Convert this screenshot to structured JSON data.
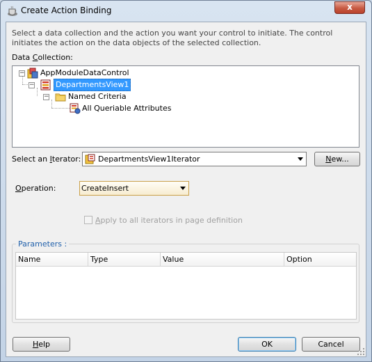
{
  "window": {
    "title": "Create Action Binding",
    "close_glyph": "x"
  },
  "description": "Select a data collection and the action you want your control to initiate. The control initiates the action on the data objects of the selected collection.",
  "data_collection": {
    "label_pre": "Data ",
    "label_key": "C",
    "label_post": "ollection:",
    "tree": [
      {
        "label": "AppModuleDataControl",
        "icon": "data-control-icon",
        "expanded": true
      },
      {
        "label": "DepartmentsView1",
        "icon": "view-object-icon",
        "expanded": true,
        "selected": true
      },
      {
        "label": "Named Criteria",
        "icon": "folder-icon",
        "expanded": true
      },
      {
        "label": "All Queriable Attributes",
        "icon": "view-criteria-icon"
      }
    ]
  },
  "iterator": {
    "label_pre": "Select an ",
    "label_key": "I",
    "label_post": "terator:",
    "value": "DepartmentsView1Iterator",
    "new_key": "N",
    "new_rest": "ew..."
  },
  "operation": {
    "label_key": "O",
    "label_post": "peration:",
    "value": "CreateInsert"
  },
  "apply_all": {
    "label_key": "A",
    "label_post": "pply to all iterators in page definition",
    "checked": false
  },
  "parameters": {
    "legend": "Parameters :",
    "columns": [
      "Name",
      "Type",
      "Value",
      "Option"
    ]
  },
  "buttons": {
    "help_key": "H",
    "help_rest": "elp",
    "ok": "OK",
    "cancel": "Cancel"
  },
  "colors": {
    "selection": "#3399ff",
    "legend_text": "#1f5faa",
    "close_button": "#c75a42"
  }
}
